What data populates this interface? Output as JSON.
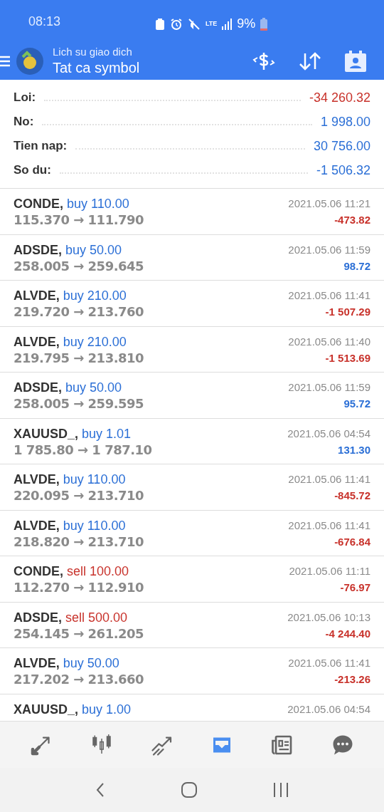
{
  "status_bar": {
    "time": "08:13",
    "network": "LTE",
    "battery": "9%"
  },
  "header": {
    "subtitle": "Lich su giao dich",
    "title": "Tat ca symbol"
  },
  "summary": [
    {
      "label": "Loi:",
      "value": "-34 260.32",
      "color": "#c8322b"
    },
    {
      "label": "No:",
      "value": "1 998.00",
      "color": "#2b6fd6"
    },
    {
      "label": "Tien nap:",
      "value": "30 756.00",
      "color": "#2b6fd6"
    },
    {
      "label": "So du:",
      "value": "-1 506.32",
      "color": "#2b6fd6"
    }
  ],
  "trades": [
    {
      "symbol": "CONDE,",
      "side": "buy",
      "volume": "110.00",
      "prices": "115.370 → 111.790",
      "time": "2021.05.06 11:21",
      "profit": "-473.82",
      "color": "#c8322b"
    },
    {
      "symbol": "ADSDE,",
      "side": "buy",
      "volume": "50.00",
      "prices": "258.005 → 259.645",
      "time": "2021.05.06 11:59",
      "profit": "98.72",
      "color": "#2b6fd6"
    },
    {
      "symbol": "ALVDE,",
      "side": "buy",
      "volume": "210.00",
      "prices": "219.720 → 213.760",
      "time": "2021.05.06 11:41",
      "profit": "-1 507.29",
      "color": "#c8322b"
    },
    {
      "symbol": "ALVDE,",
      "side": "buy",
      "volume": "210.00",
      "prices": "219.795 → 213.810",
      "time": "2021.05.06 11:40",
      "profit": "-1 513.69",
      "color": "#c8322b"
    },
    {
      "symbol": "ADSDE,",
      "side": "buy",
      "volume": "50.00",
      "prices": "258.005 → 259.595",
      "time": "2021.05.06 11:59",
      "profit": "95.72",
      "color": "#2b6fd6"
    },
    {
      "symbol": "XAUUSD_,",
      "side": "buy",
      "volume": "1.01",
      "prices": "1 785.80 → 1 787.10",
      "time": "2021.05.06 04:54",
      "profit": "131.30",
      "color": "#2b6fd6"
    },
    {
      "symbol": "ALVDE,",
      "side": "buy",
      "volume": "110.00",
      "prices": "220.095 → 213.710",
      "time": "2021.05.06 11:41",
      "profit": "-845.72",
      "color": "#c8322b"
    },
    {
      "symbol": "ALVDE,",
      "side": "buy",
      "volume": "110.00",
      "prices": "218.820 → 213.710",
      "time": "2021.05.06 11:41",
      "profit": "-676.84",
      "color": "#c8322b"
    },
    {
      "symbol": "CONDE,",
      "side": "sell",
      "volume": "100.00",
      "prices": "112.270 → 112.910",
      "time": "2021.05.06 11:11",
      "profit": "-76.97",
      "color": "#c8322b"
    },
    {
      "symbol": "ADSDE,",
      "side": "sell",
      "volume": "500.00",
      "prices": "254.145 → 261.205",
      "time": "2021.05.06 10:13",
      "profit": "-4 244.40",
      "color": "#c8322b"
    },
    {
      "symbol": "ALVDE,",
      "side": "buy",
      "volume": "50.00",
      "prices": "217.202 → 213.660",
      "time": "2021.05.06 11:41",
      "profit": "-213.26",
      "color": "#c8322b"
    },
    {
      "symbol": "XAUUSD_,",
      "side": "buy",
      "volume": "1.00",
      "time": "2021.05.06 04:54"
    }
  ],
  "bottom_nav": [
    {
      "kind": "quotes",
      "selected": false
    },
    {
      "kind": "chart",
      "selected": false
    },
    {
      "kind": "trade",
      "selected": false
    },
    {
      "kind": "history",
      "selected": true
    },
    {
      "kind": "news",
      "selected": false
    },
    {
      "kind": "chat",
      "selected": false
    }
  ]
}
